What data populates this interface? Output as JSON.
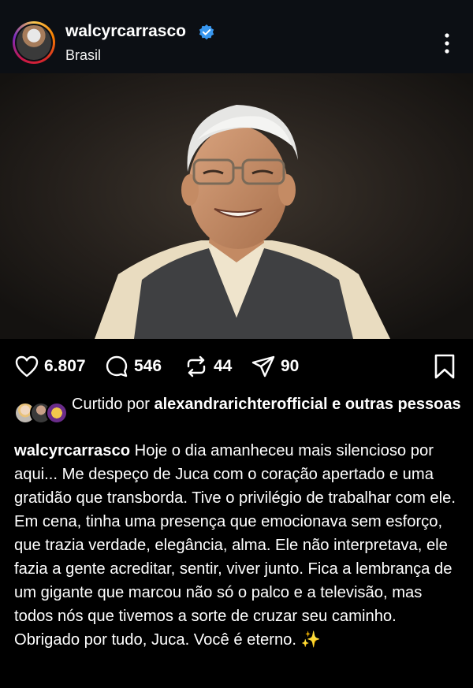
{
  "header": {
    "username": "walcyrcarrasco",
    "location": "Brasil",
    "verified": true
  },
  "post": {
    "image_alt": "Retrato de homem de cabelos brancos e óculos, sorrindo, com colete escuro sobre camisa clara"
  },
  "actions": {
    "likes_count": "6.807",
    "comments_count": "546",
    "reposts_count": "44",
    "shares_count": "90"
  },
  "liked_by": {
    "prefix": "Curtido por",
    "user": "alexandrarichterofficial",
    "suffix": "e outras pessoas"
  },
  "caption": {
    "username": "walcyrcarrasco",
    "text": "Hoje o dia amanheceu mais silencioso por aqui... Me despeço de Juca com o coração apertado e uma gratidão que transborda. Tive o privilégio de trabalhar com ele. Em cena, tinha uma presença que emocionava sem esforço, que trazia verdade, elegância, alma. Ele não interpretava, ele fazia a gente acreditar, sentir, viver junto. Fica a lembrança de um gigante que marcou não só o palco e a televisão, mas todos nós que tivemos a sorte de cruzar seu caminho. Obrigado por tudo, Juca. Você é eterno.",
    "emoji": "✨"
  },
  "colors": {
    "verified_blue": "#3897f0",
    "header_bg": "#0c0f14",
    "background": "#000000"
  }
}
